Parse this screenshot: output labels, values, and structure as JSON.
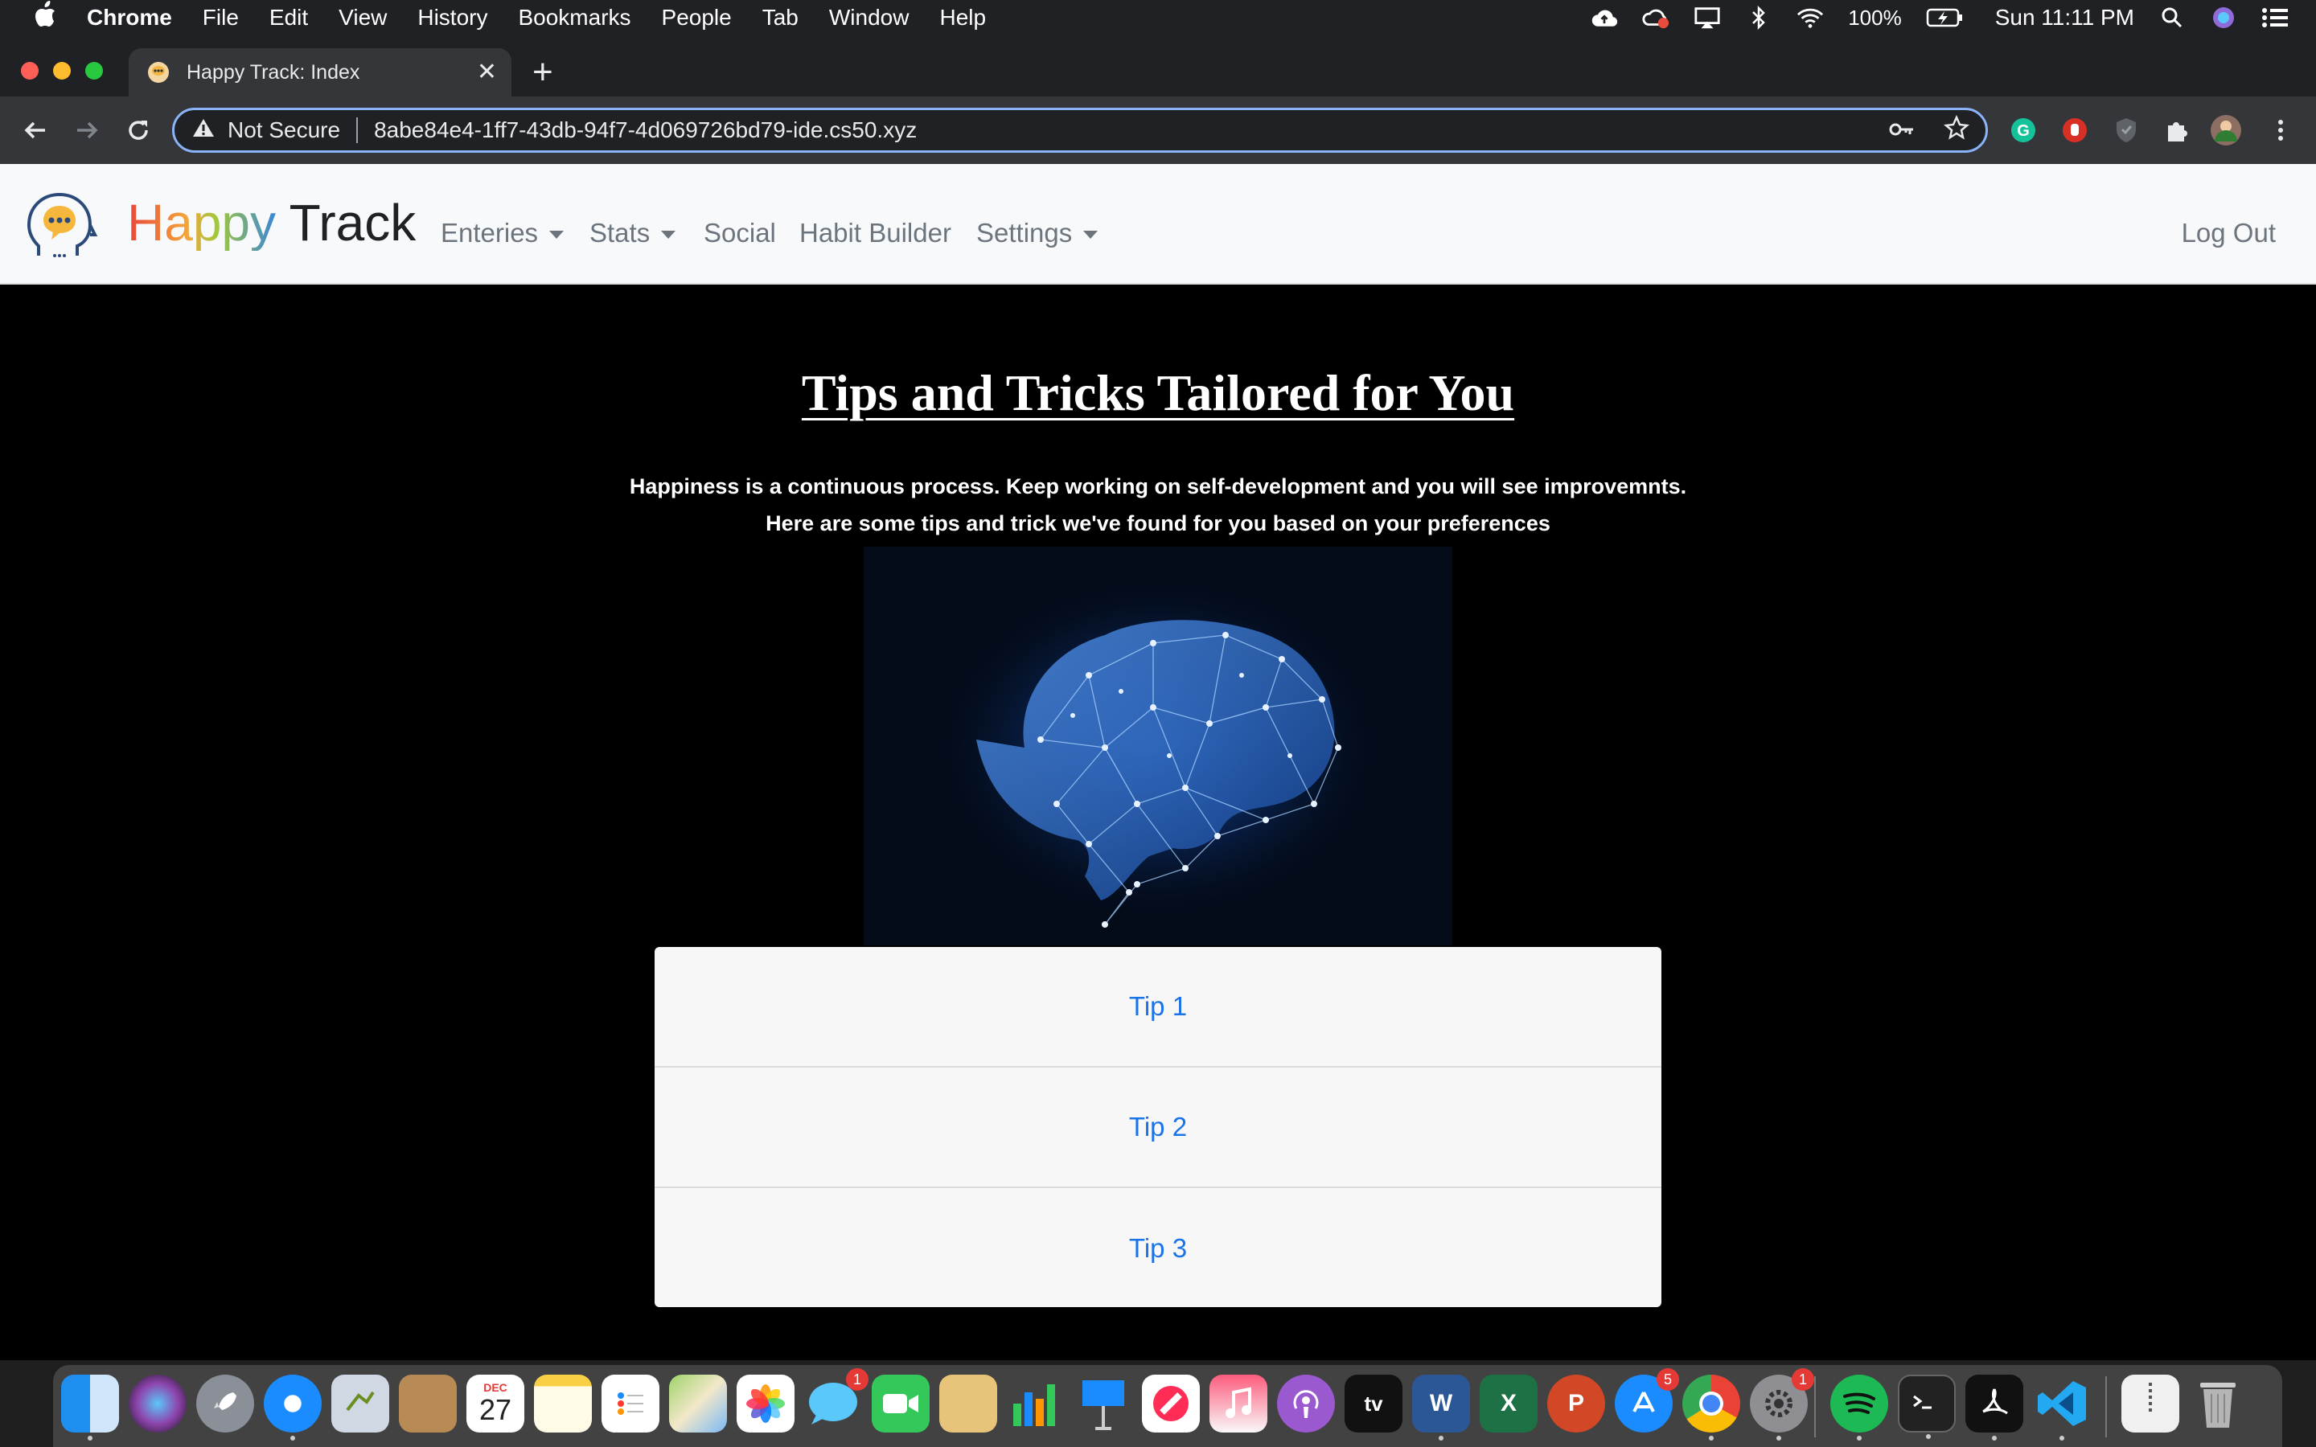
{
  "menubar": {
    "app_name": "Chrome",
    "items": [
      "File",
      "Edit",
      "View",
      "History",
      "Bookmarks",
      "People",
      "Tab",
      "Window",
      "Help"
    ],
    "battery": "100%",
    "clock": "Sun 11:11 PM"
  },
  "browser": {
    "tab_title": "Happy Track: Index",
    "security_label": "Not Secure",
    "url": "8abe84e4-1ff7-43db-94f7-4d069726bd79-ide.cs50.xyz"
  },
  "navbar": {
    "brand_happy": "Happy",
    "brand_track": "Track",
    "links": {
      "entries": "Enteries",
      "stats": "Stats",
      "social": "Social",
      "habit_builder": "Habit Builder",
      "settings": "Settings"
    },
    "logout": "Log Out"
  },
  "main": {
    "heading": "Tips and Tricks Tailored for You",
    "intro_line1": "Happiness is a continuous process. Keep working on self-development and you will see improvemnts.",
    "intro_line2": "Here are some tips and trick we've found for you based on your preferences",
    "tips": [
      "Tip 1",
      "Tip 2",
      "Tip 3"
    ]
  },
  "dock": {
    "calendar_month": "DEC",
    "calendar_day": "27",
    "messages_badge": "1",
    "appstore_badge": "5",
    "prefs_badge": "1",
    "tv_label": "tv",
    "word_letter": "W",
    "excel_letter": "X",
    "ppt_letter": "P"
  },
  "colors": {
    "link_blue": "#1a73e8",
    "navbar_bg": "#f8f9fa",
    "page_bg": "#000000",
    "omnibox_focus": "#8ab4f8"
  }
}
